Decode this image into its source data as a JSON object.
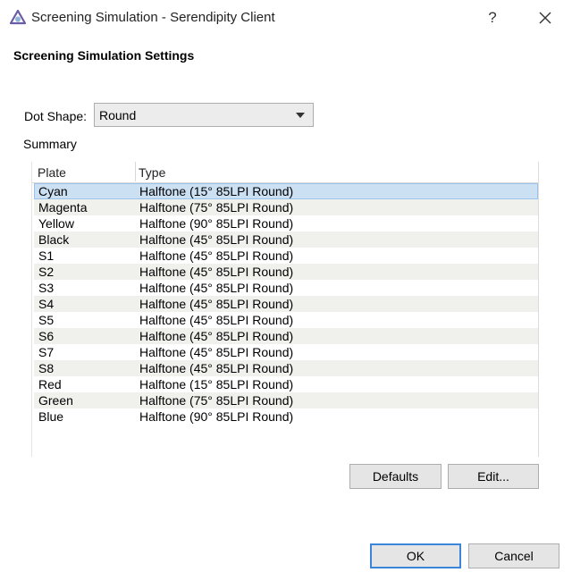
{
  "window": {
    "title": "Screening Simulation - Serendipity Client",
    "help": "?"
  },
  "heading": "Screening Simulation Settings",
  "dot_shape": {
    "label": "Dot Shape:",
    "value": "Round"
  },
  "summary": {
    "label": "Summary",
    "columns": [
      "Plate",
      "Type"
    ],
    "rows": [
      {
        "plate": "Cyan",
        "type": "Halftone (15° 85LPI Round)"
      },
      {
        "plate": "Magenta",
        "type": "Halftone (75° 85LPI Round)"
      },
      {
        "plate": "Yellow",
        "type": "Halftone (90° 85LPI Round)"
      },
      {
        "plate": "Black",
        "type": "Halftone (45° 85LPI Round)"
      },
      {
        "plate": "S1",
        "type": "Halftone (45° 85LPI Round)"
      },
      {
        "plate": "S2",
        "type": "Halftone (45° 85LPI Round)"
      },
      {
        "plate": "S3",
        "type": "Halftone (45° 85LPI Round)"
      },
      {
        "plate": "S4",
        "type": "Halftone (45° 85LPI Round)"
      },
      {
        "plate": "S5",
        "type": "Halftone (45° 85LPI Round)"
      },
      {
        "plate": "S6",
        "type": "Halftone (45° 85LPI Round)"
      },
      {
        "plate": "S7",
        "type": "Halftone (45° 85LPI Round)"
      },
      {
        "plate": "S8",
        "type": "Halftone (45° 85LPI Round)"
      },
      {
        "plate": "Red",
        "type": "Halftone (15° 85LPI Round)"
      },
      {
        "plate": "Green",
        "type": "Halftone (75° 85LPI Round)"
      },
      {
        "plate": "Blue",
        "type": "Halftone (90° 85LPI Round)"
      }
    ]
  },
  "buttons": {
    "defaults": "Defaults",
    "edit": "Edit...",
    "ok": "OK",
    "cancel": "Cancel"
  },
  "colors": {
    "selection": "#cce0f4",
    "alt_row": "#f0f0ed",
    "accent": "#3b86d8"
  },
  "icons": {
    "app": "serendipity-logo-icon",
    "close": "close-icon",
    "dropdown": "chevron-down-icon"
  }
}
